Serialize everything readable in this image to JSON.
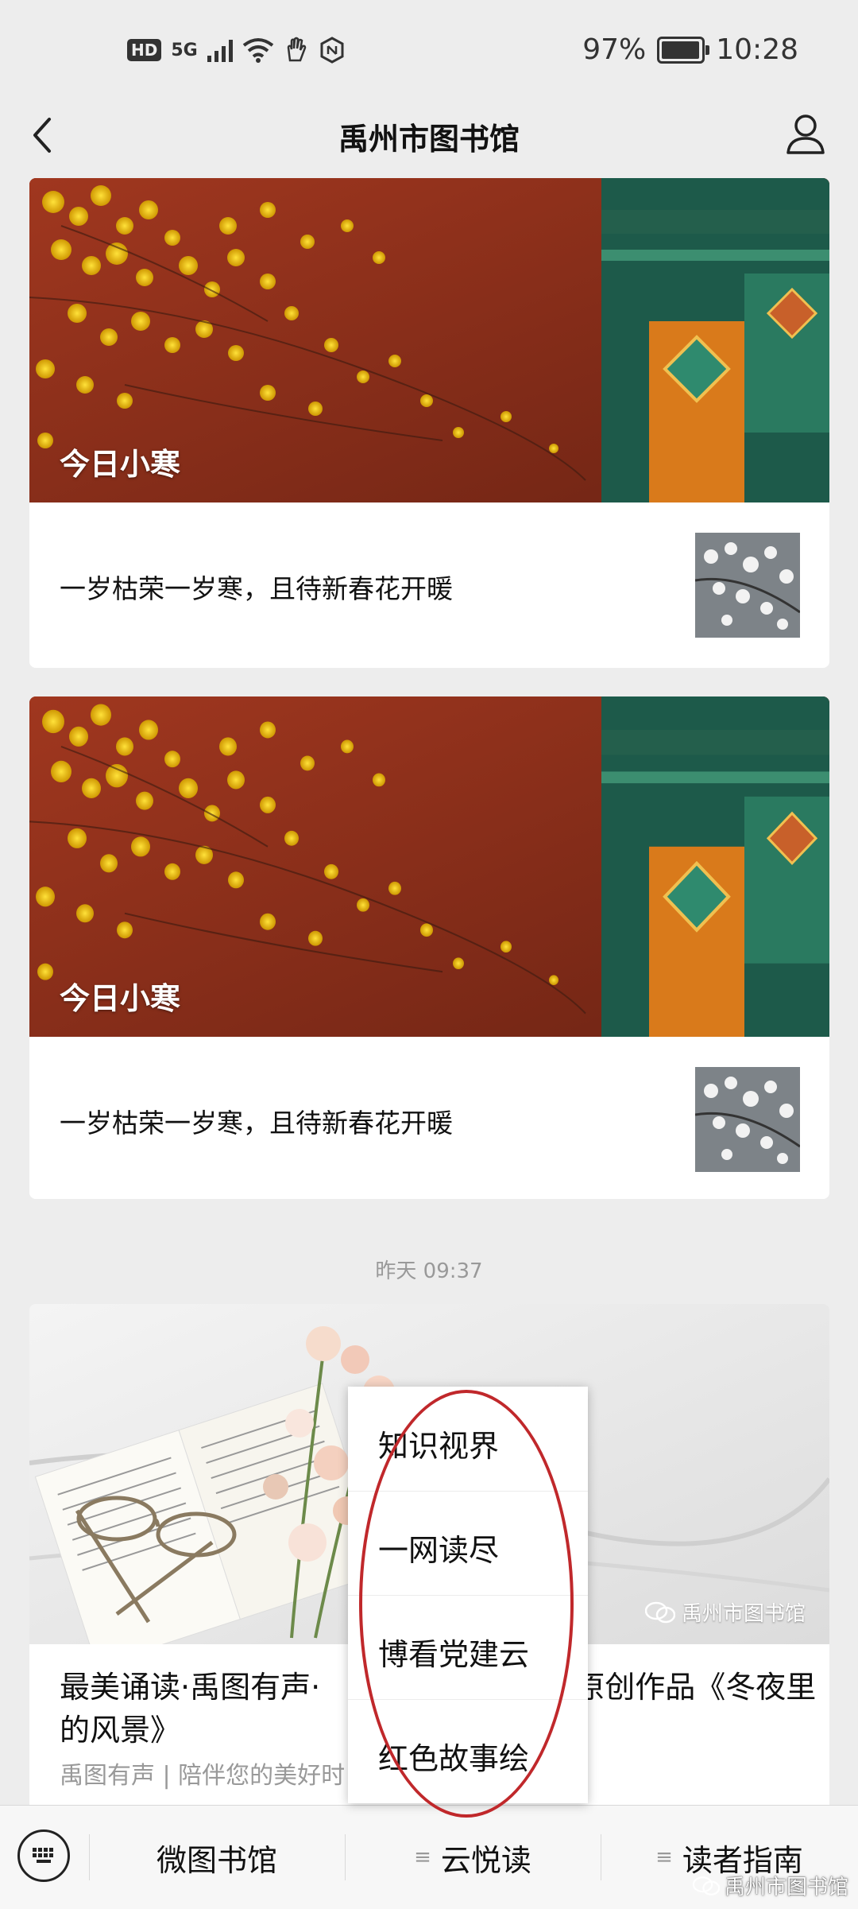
{
  "status_bar": {
    "hd": "HD",
    "network": "5G",
    "battery_percent": "97%",
    "battery_level": 0.97,
    "time": "10:28"
  },
  "nav": {
    "title": "禹州市图书馆",
    "back_icon": "chevron-left-icon",
    "user_icon": "person-icon"
  },
  "feed": {
    "cards": [
      {
        "cover_title": "今日小寒",
        "sub_article": "一岁枯荣一岁寒，且待新春花开暖"
      },
      {
        "cover_title": "今日小寒",
        "sub_article": "一岁枯荣一岁寒，且待新春花开暖"
      }
    ],
    "timestamp": "昨天 09:37",
    "article": {
      "title_part1": "最美诵读·禹图有声·",
      "title_part2": "夜原创作品《冬夜里的风景》",
      "meta": "禹图有声 | 陪伴您的美好时",
      "watermark": "禹州市图书馆"
    }
  },
  "popup_menu": {
    "items": [
      "知识视界",
      "一网读尽",
      "博看党建云",
      "红色故事绘"
    ]
  },
  "bottom_menu": {
    "keyboard_icon": "keyboard-icon",
    "tabs": [
      "微图书馆",
      "云悦读",
      "读者指南"
    ]
  },
  "corner_watermark": "禹州市图书馆",
  "colors": {
    "accent_red": "#c0282b",
    "cover_red": "#8c2e1c",
    "muted_text": "#999999"
  }
}
